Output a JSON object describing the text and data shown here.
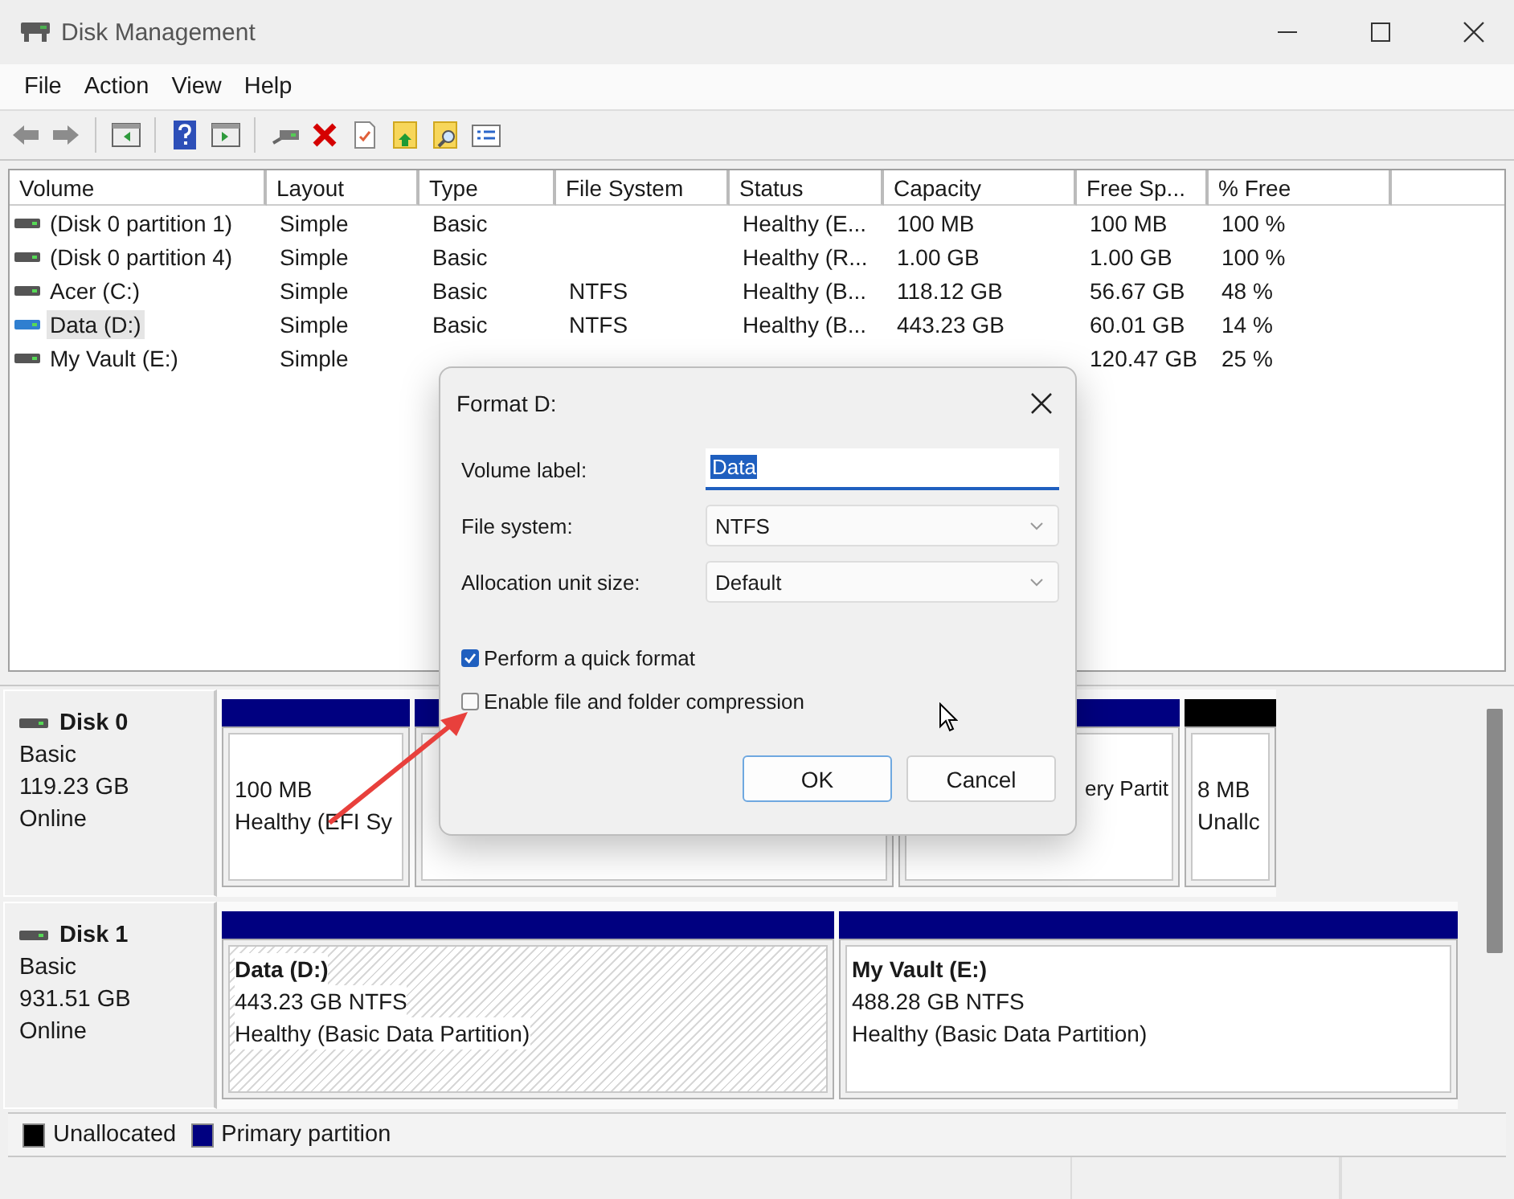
{
  "window": {
    "title": "Disk Management"
  },
  "menu": [
    "File",
    "Action",
    "View",
    "Help"
  ],
  "volume_table": {
    "columns": [
      "Volume",
      "Layout",
      "Type",
      "File System",
      "Status",
      "Capacity",
      "Free Sp...",
      "% Free"
    ],
    "rows": [
      {
        "kind": "disk",
        "selected": false,
        "volume": "(Disk 0 partition 1)",
        "layout": "Simple",
        "type": "Basic",
        "status": "Healthy (E...",
        "capacity": "100 MB",
        "free_space": "100 MB",
        "percent_free": "100 %"
      },
      {
        "kind": "disk",
        "selected": false,
        "volume": "(Disk 0 partition 4)",
        "layout": "Simple",
        "type": "Basic",
        "status": "Healthy (R...",
        "capacity": "1.00 GB",
        "free_space": "1.00 GB",
        "percent_free": "100 %"
      },
      {
        "kind": "disk",
        "selected": false,
        "volume": "Acer (C:)",
        "layout": "Simple",
        "type": "Basic",
        "file_system": "NTFS",
        "status": "Healthy (B...",
        "capacity": "118.12 GB",
        "free_space": "56.67 GB",
        "percent_free": "48 %"
      },
      {
        "kind": "disk",
        "selected": true,
        "volume": "Data (D:)",
        "layout": "Simple",
        "type": "Basic",
        "file_system": "NTFS",
        "status": "Healthy (B...",
        "capacity": "443.23 GB",
        "free_space": "60.01 GB",
        "percent_free": "14 %"
      },
      {
        "kind": "disk",
        "selected": false,
        "volume": "My Vault (E:)",
        "layout": "Simple",
        "free_space": "120.47 GB",
        "percent_free": "25 %"
      }
    ]
  },
  "disks": [
    {
      "name": "Disk 0",
      "type": "Basic",
      "size": "119.23 GB",
      "status": "Online",
      "partitions": [
        {
          "kind": "primary",
          "selected": false,
          "lines": [
            "100 MB",
            "Healthy (EFI Sy"
          ]
        },
        {
          "kind": "primary",
          "selected": false
        },
        {
          "kind": "primary",
          "selected": false,
          "cut_left": true,
          "lines": [
            "ery Partit"
          ]
        },
        {
          "kind": "unallocated",
          "selected": false,
          "lines": [
            "8 MB",
            "Unallc"
          ]
        }
      ]
    },
    {
      "name": "Disk 1",
      "type": "Basic",
      "size": "931.51 GB",
      "status": "Online",
      "partitions": [
        {
          "kind": "primary",
          "selected": true,
          "title": "Data  (D:)",
          "lines": [
            "443.23 GB NTFS",
            "Healthy (Basic Data Partition)"
          ]
        },
        {
          "kind": "primary",
          "selected": false,
          "title": "My Vault  (E:)",
          "lines": [
            "488.28 GB NTFS",
            "Healthy (Basic Data Partition)"
          ]
        }
      ]
    }
  ],
  "legend": [
    {
      "label": "Unallocated",
      "color": "#000000"
    },
    {
      "label": "Primary partition",
      "color": "#000080"
    }
  ],
  "dialog": {
    "title": "Format D:",
    "fields": [
      {
        "kind": "text",
        "label": "Volume label:",
        "value": "Data"
      },
      {
        "kind": "dropdown",
        "label": "File system:",
        "value": "NTFS"
      },
      {
        "kind": "dropdown",
        "label": "Allocation unit size:",
        "value": "Default"
      }
    ],
    "options": [
      {
        "label": "Perform a quick format",
        "checked": true
      },
      {
        "label": "Enable file and folder compression",
        "checked": false
      }
    ],
    "buttons": [
      {
        "label": "OK",
        "default": true
      },
      {
        "label": "Cancel",
        "default": false
      }
    ]
  }
}
